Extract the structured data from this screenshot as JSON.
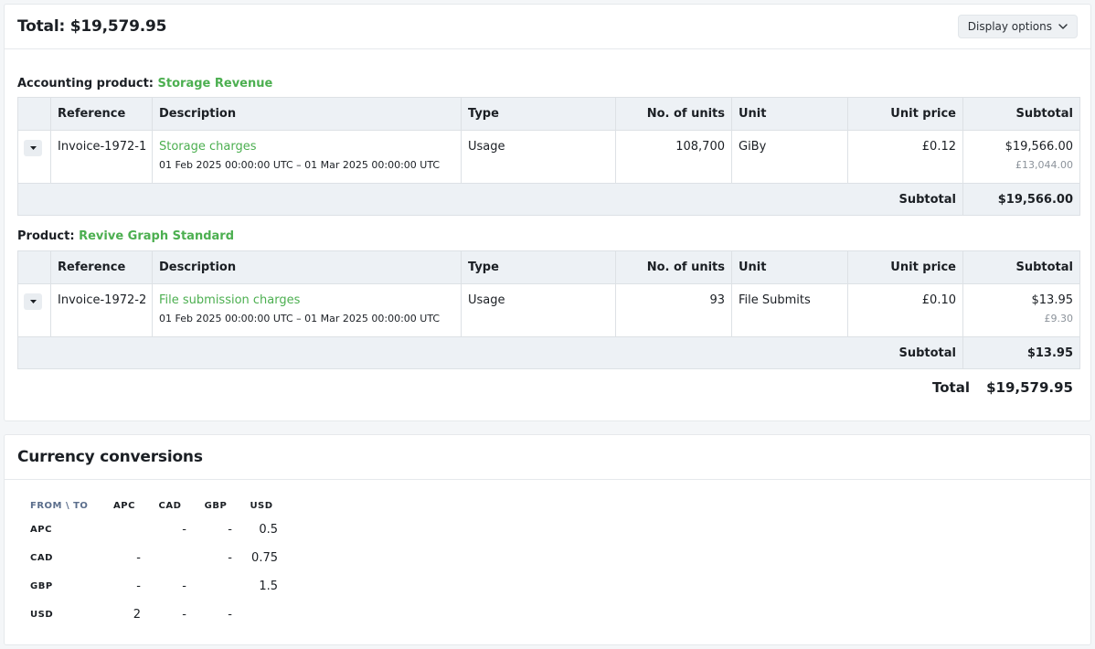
{
  "invoice_card": {
    "title": "Total: $19,579.95",
    "display_options_label": "Display options",
    "columns": {
      "reference": "Reference",
      "description": "Description",
      "type": "Type",
      "units": "No. of units",
      "unit": "Unit",
      "unit_price": "Unit price",
      "subtotal": "Subtotal"
    },
    "sections": [
      {
        "heading_prefix": "Accounting product:",
        "heading_name": "Storage Revenue",
        "line": {
          "reference": "Invoice-1972-1",
          "description": "Storage charges",
          "period": "01 Feb 2025 00:00:00 UTC – 01 Mar 2025 00:00:00 UTC",
          "type": "Usage",
          "units": "108,700",
          "unit": "GiBy",
          "unit_price": "£0.12",
          "subtotal": "$19,566.00",
          "subtotal_secondary": "£13,044.00"
        },
        "subtotal_label": "Subtotal",
        "subtotal_value": "$19,566.00"
      },
      {
        "heading_prefix": "Product:",
        "heading_name": "Revive Graph Standard",
        "line": {
          "reference": "Invoice-1972-2",
          "description": "File submission charges",
          "period": "01 Feb 2025 00:00:00 UTC – 01 Mar 2025 00:00:00 UTC",
          "type": "Usage",
          "units": "93",
          "unit": "File Submits",
          "unit_price": "£0.10",
          "subtotal": "$13.95",
          "subtotal_secondary": "£9.30"
        },
        "subtotal_label": "Subtotal",
        "subtotal_value": "$13.95"
      }
    ],
    "total_label": "Total",
    "total_value": "$19,579.95"
  },
  "currency_card": {
    "title": "Currency conversions",
    "corner_label": "FROM \\ TO",
    "columns": [
      "APC",
      "CAD",
      "GBP",
      "USD"
    ],
    "rows": [
      {
        "from": "APC",
        "cells": [
          "",
          "-",
          "-",
          "0.5"
        ]
      },
      {
        "from": "CAD",
        "cells": [
          "-",
          "",
          "-",
          "0.75"
        ]
      },
      {
        "from": "GBP",
        "cells": [
          "-",
          "-",
          "",
          "1.5"
        ]
      },
      {
        "from": "USD",
        "cells": [
          "2",
          "-",
          "-",
          ""
        ]
      }
    ]
  },
  "icons": {
    "display_options": "chevron-down-icon",
    "row_toggle": "caret-down-icon"
  },
  "colors": {
    "accent_green": "#4caf50",
    "header_bg": "#edf1f5",
    "muted_text": "#8c939b",
    "corner_label": "#5b6e8c"
  }
}
